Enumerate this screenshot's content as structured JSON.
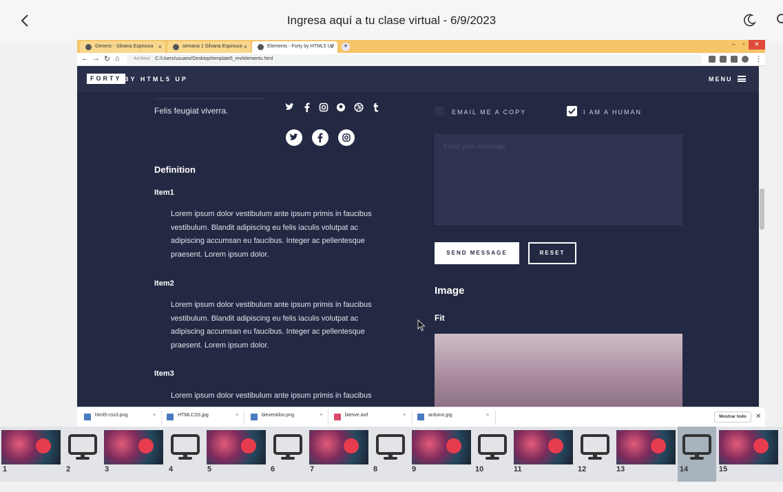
{
  "viewer": {
    "title": "Ingresa aquí a tu clase virtual - 6/9/2023"
  },
  "browser": {
    "tabs": [
      {
        "label": "Generic - Silvana Espinoza"
      },
      {
        "label": "semana 1 Silvana Espinoza"
      },
      {
        "label": "Elements - Forty by HTML5 UP"
      }
    ],
    "url_prefix": "Archivo",
    "url": "C:/Users/usuario/Desktop/template5_mv/elements.html"
  },
  "site": {
    "logo": "FORTY",
    "logo_sub": "BY HTML5 UP",
    "menu": "MENU",
    "left": {
      "intro": "Felis feugiat viverra.",
      "heading": "Definition",
      "items": [
        {
          "title": "Item1",
          "text": "Lorem ipsum dolor vestibulum ante ipsum primis in faucibus vestibulum. Blandit adipiscing eu felis iaculis volutpat ac adipiscing accumsan eu faucibus. Integer ac pellentesque praesent. Lorem ipsum dolor."
        },
        {
          "title": "Item2",
          "text": "Lorem ipsum dolor vestibulum ante ipsum primis in faucibus vestibulum. Blandit adipiscing eu felis iaculis volutpat ac adipiscing accumsan eu faucibus. Integer ac pellentesque praesent. Lorem ipsum dolor."
        },
        {
          "title": "Item3",
          "text": "Lorem ipsum dolor vestibulum ante ipsum primis in faucibus"
        }
      ]
    },
    "form": {
      "email_copy": "EMAIL ME A COPY",
      "human": "I AM A HUMAN",
      "message_placeholder": "Enter your message",
      "send": "SEND MESSAGE",
      "reset": "RESET"
    },
    "image_heading": "Image",
    "fit_heading": "Fit"
  },
  "downloads": {
    "files": [
      {
        "name": "html5-css3.png"
      },
      {
        "name": "HTMLCSS.jpg"
      },
      {
        "name": "bievenidos.png"
      },
      {
        "name": "bienve.avif"
      },
      {
        "name": "arduino.jpg"
      }
    ],
    "show_all": "Mostrar todo"
  },
  "thumbnails": [
    "1",
    "2",
    "3",
    "4",
    "5",
    "6",
    "7",
    "8",
    "9",
    "10",
    "11",
    "12",
    "13",
    "14",
    "15"
  ],
  "colors": {
    "site_bg": "#242943",
    "tab_bar": "#f5c569",
    "active_thumb": "#a8b3bd"
  }
}
